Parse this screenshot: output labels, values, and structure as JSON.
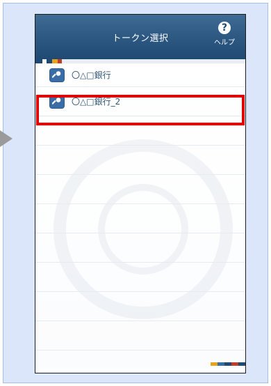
{
  "header": {
    "title": "トークン選択",
    "help_label": "ヘルプ",
    "help_glyph": "?"
  },
  "tokens": [
    {
      "label": "〇△□銀行",
      "icon": "key-icon"
    },
    {
      "label": "〇△□銀行_2",
      "icon": "key-icon"
    }
  ],
  "colors": {
    "header": "#2e5a84",
    "highlight": "#e00000",
    "panel_bg": "#dbe6fb",
    "key_button": "#3a6da6",
    "accent_stripe": [
      "#1e4a74",
      "#e8a31a",
      "#c23c2a",
      "#3a6da6"
    ]
  }
}
